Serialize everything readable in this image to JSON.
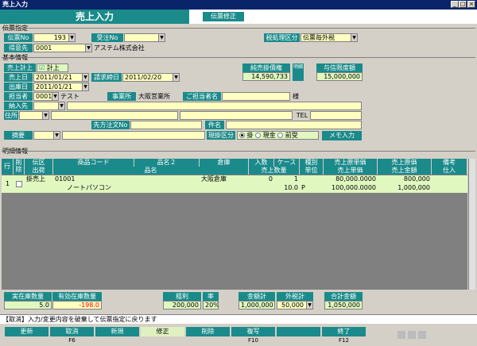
{
  "window": {
    "title": "売上入力"
  },
  "app": {
    "title": "売上入力",
    "badge": "伝票修正"
  },
  "voucher": {
    "section": "伝票指定",
    "no_label": "伝票No",
    "no_value": "193",
    "order_label": "受注No",
    "order_value": "",
    "tax_label": "税処理区分",
    "tax_value": "伝票毎外税",
    "client_label": "得意先",
    "client_code": "0001",
    "client_name": "アステム株式会社"
  },
  "basic": {
    "section": "基本情報",
    "post_label": "売上計上",
    "post_check_label": "計上",
    "date_label": "売上日",
    "date_value": "2011/01/21",
    "close_label": "請求締日",
    "close_value": "2011/02/20",
    "ship_label": "出庫日",
    "ship_value": "2011/01/21",
    "staff_label": "担当者",
    "staff_code": "0001",
    "staff_name": "テスト",
    "office_label": "事業所",
    "office_value": "大阪営業所",
    "person_label": "ご担当者名",
    "person_suffix": "様",
    "recv_label": "納入先",
    "addr_label": "住所",
    "tel_label": "TEL",
    "po_label": "先方注文No",
    "subject_label": "件名",
    "memo_label": "摘要",
    "pay_label": "現掛区分",
    "pay_options": [
      "掛",
      "現金",
      "前受"
    ],
    "memo_button": "メモ入力",
    "balance_label": "純売掛債権",
    "balance_value": "14,590,733",
    "credit_label": "与信限度額",
    "credit_value": "15,000,000",
    "side_button": "明細"
  },
  "detail": {
    "section": "明細情報",
    "headers_top": [
      "行No",
      "削除",
      "伝区",
      "商品コード",
      "品名２",
      "倉庫",
      "入数",
      "ケース",
      "種別",
      "売上原単価",
      "売上原価",
      "備考"
    ],
    "headers_bottom": [
      "出荷",
      "品名",
      "売上数量",
      "単位",
      "売上単価",
      "売上金額",
      "仕入"
    ],
    "rows": [
      {
        "no": "1",
        "type": "掛売上",
        "code": "01001",
        "warehouse": "大阪倉庫",
        "per": "0",
        "case": "1",
        "cost_unit": "80,000.0000",
        "cost": "800,000",
        "name": "ノートパソコン",
        "qty": "10.0",
        "unit": "P",
        "price": "100,000.0000",
        "amount": "1,000,000"
      }
    ]
  },
  "totals": {
    "stock_label": "実在庫数量",
    "stock_value": "5.0",
    "avail_label": "有効在庫数量",
    "avail_value": "-198.0",
    "profit_label": "粗利",
    "profit_value": "200,000",
    "rate_label": "率",
    "rate_value": "20%",
    "sum_label": "金額計",
    "sum_value": "1,000,000",
    "tax_label": "外税計",
    "tax_value": "50,000",
    "total_label": "合計金額",
    "total_value": "1,050,000"
  },
  "status": "【取消】入力/変更内容を破棄して伝票指定に戻ります",
  "fkeys": [
    {
      "label": "更新",
      "key": ""
    },
    {
      "label": "取消",
      "key": "F6"
    },
    {
      "label": "新規",
      "key": ""
    },
    {
      "label": "修正",
      "key": ""
    },
    {
      "label": "削除",
      "key": ""
    },
    {
      "label": "複写",
      "key": "F10"
    },
    {
      "label": "",
      "key": ""
    },
    {
      "label": "終了",
      "key": "F12"
    }
  ],
  "colors": {
    "accent": "#1b8a8a",
    "input": "#ffffc0",
    "input_alt": "#e0f8c0",
    "negative": "#ff0000"
  }
}
